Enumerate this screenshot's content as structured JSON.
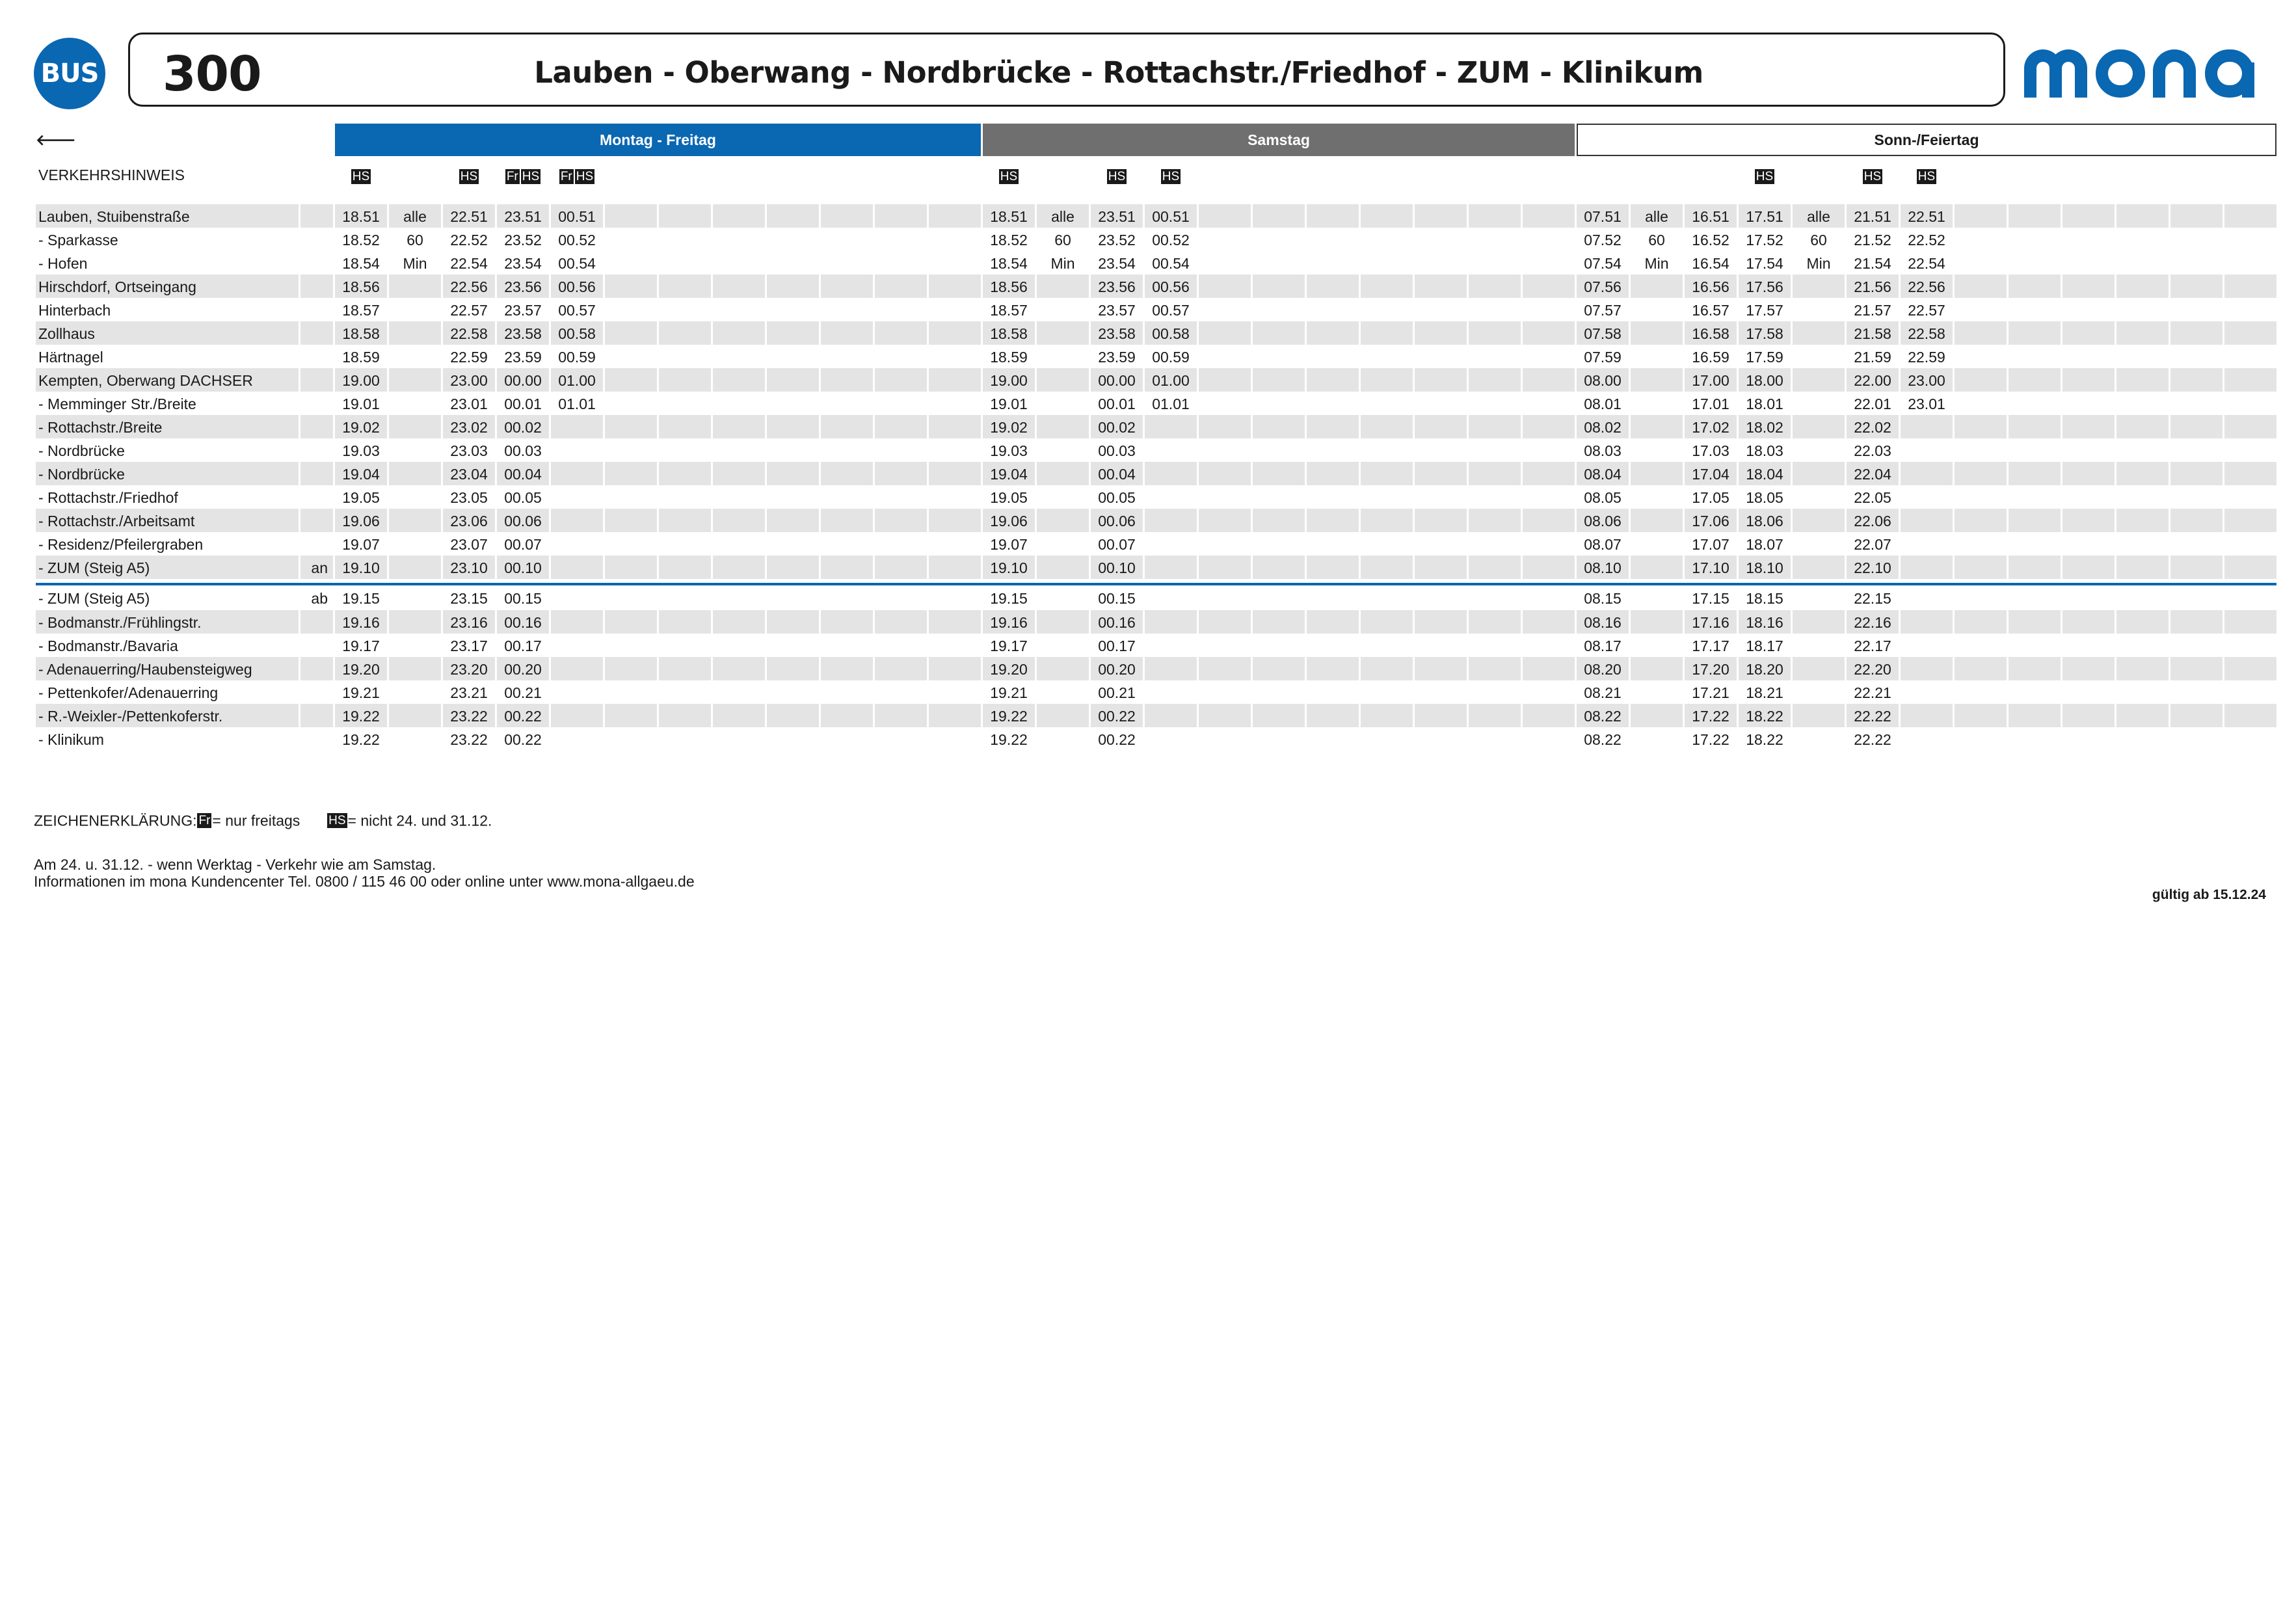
{
  "header": {
    "bus_label": "BUS",
    "line_number": "300",
    "route_title": "Lauben - Oberwang - Nordbrücke - Rottachstr./Friedhof - ZUM - Klinikum",
    "logo_text": "mona",
    "logo_color": "#0a67b2"
  },
  "bands": {
    "back_arrow": "🡐",
    "weekday": "Montag - Freitag",
    "saturday": "Samstag",
    "sunday": "Sonn-/Feiertag",
    "weekday_color": "#0a67b2",
    "saturday_color": "#6f6f6f"
  },
  "notes_label": "VERKEHRSHINWEIS",
  "columns": 36,
  "note_tags": [
    [
      "HS"
    ],
    [],
    [
      "HS"
    ],
    [
      "Fr",
      "HS"
    ],
    [
      "Fr",
      "HS"
    ],
    [],
    [],
    [],
    [],
    [],
    [],
    [],
    [
      "HS"
    ],
    [],
    [
      "HS"
    ],
    [
      "HS"
    ],
    [],
    [],
    [],
    [],
    [],
    [],
    [],
    [],
    [],
    [],
    [
      "HS"
    ],
    [],
    [
      "HS"
    ],
    [
      "HS"
    ],
    [],
    [],
    [],
    [],
    [],
    []
  ],
  "section1": [
    {
      "stop": "Lauben, Stuibenstraße",
      "ank": "",
      "shaded": true,
      "times": [
        "18.51",
        "alle",
        "22.51",
        "23.51",
        "00.51",
        "",
        "",
        "",
        "",
        "",
        "",
        "",
        "18.51",
        "alle",
        "23.51",
        "00.51",
        "",
        "",
        "",
        "",
        "",
        "",
        "",
        "07.51",
        "alle",
        "16.51",
        "17.51",
        "alle",
        "21.51",
        "22.51",
        "",
        "",
        "",
        "",
        "",
        ""
      ]
    },
    {
      "stop": "- Sparkasse",
      "ank": "",
      "shaded": false,
      "times": [
        "18.52",
        "60",
        "22.52",
        "23.52",
        "00.52",
        "",
        "",
        "",
        "",
        "",
        "",
        "",
        "18.52",
        "60",
        "23.52",
        "00.52",
        "",
        "",
        "",
        "",
        "",
        "",
        "",
        "07.52",
        "60",
        "16.52",
        "17.52",
        "60",
        "21.52",
        "22.52",
        "",
        "",
        "",
        "",
        "",
        ""
      ]
    },
    {
      "stop": "- Hofen",
      "ank": "",
      "shaded": false,
      "times": [
        "18.54",
        "Min",
        "22.54",
        "23.54",
        "00.54",
        "",
        "",
        "",
        "",
        "",
        "",
        "",
        "18.54",
        "Min",
        "23.54",
        "00.54",
        "",
        "",
        "",
        "",
        "",
        "",
        "",
        "07.54",
        "Min",
        "16.54",
        "17.54",
        "Min",
        "21.54",
        "22.54",
        "",
        "",
        "",
        "",
        "",
        ""
      ]
    },
    {
      "stop": "Hirschdorf, Ortseingang",
      "ank": "",
      "shaded": true,
      "times": [
        "18.56",
        "",
        "22.56",
        "23.56",
        "00.56",
        "",
        "",
        "",
        "",
        "",
        "",
        "",
        "18.56",
        "",
        "23.56",
        "00.56",
        "",
        "",
        "",
        "",
        "",
        "",
        "",
        "07.56",
        "",
        "16.56",
        "17.56",
        "",
        "21.56",
        "22.56",
        "",
        "",
        "",
        "",
        "",
        ""
      ]
    },
    {
      "stop": "Hinterbach",
      "ank": "",
      "shaded": false,
      "times": [
        "18.57",
        "",
        "22.57",
        "23.57",
        "00.57",
        "",
        "",
        "",
        "",
        "",
        "",
        "",
        "18.57",
        "",
        "23.57",
        "00.57",
        "",
        "",
        "",
        "",
        "",
        "",
        "",
        "07.57",
        "",
        "16.57",
        "17.57",
        "",
        "21.57",
        "22.57",
        "",
        "",
        "",
        "",
        "",
        ""
      ]
    },
    {
      "stop": "Zollhaus",
      "ank": "",
      "shaded": true,
      "times": [
        "18.58",
        "",
        "22.58",
        "23.58",
        "00.58",
        "",
        "",
        "",
        "",
        "",
        "",
        "",
        "18.58",
        "",
        "23.58",
        "00.58",
        "",
        "",
        "",
        "",
        "",
        "",
        "",
        "07.58",
        "",
        "16.58",
        "17.58",
        "",
        "21.58",
        "22.58",
        "",
        "",
        "",
        "",
        "",
        ""
      ]
    },
    {
      "stop": "Härtnagel",
      "ank": "",
      "shaded": false,
      "times": [
        "18.59",
        "",
        "22.59",
        "23.59",
        "00.59",
        "",
        "",
        "",
        "",
        "",
        "",
        "",
        "18.59",
        "",
        "23.59",
        "00.59",
        "",
        "",
        "",
        "",
        "",
        "",
        "",
        "07.59",
        "",
        "16.59",
        "17.59",
        "",
        "21.59",
        "22.59",
        "",
        "",
        "",
        "",
        "",
        ""
      ]
    },
    {
      "stop": "Kempten, Oberwang DACHSER",
      "ank": "",
      "shaded": true,
      "times": [
        "19.00",
        "",
        "23.00",
        "00.00",
        "01.00",
        "",
        "",
        "",
        "",
        "",
        "",
        "",
        "19.00",
        "",
        "00.00",
        "01.00",
        "",
        "",
        "",
        "",
        "",
        "",
        "",
        "08.00",
        "",
        "17.00",
        "18.00",
        "",
        "22.00",
        "23.00",
        "",
        "",
        "",
        "",
        "",
        ""
      ]
    },
    {
      "stop": "- Memminger Str./Breite",
      "ank": "",
      "shaded": false,
      "times": [
        "19.01",
        "",
        "23.01",
        "00.01",
        "01.01",
        "",
        "",
        "",
        "",
        "",
        "",
        "",
        "19.01",
        "",
        "00.01",
        "01.01",
        "",
        "",
        "",
        "",
        "",
        "",
        "",
        "08.01",
        "",
        "17.01",
        "18.01",
        "",
        "22.01",
        "23.01",
        "",
        "",
        "",
        "",
        "",
        ""
      ]
    },
    {
      "stop": "- Rottachstr./Breite",
      "ank": "",
      "shaded": true,
      "times": [
        "19.02",
        "",
        "23.02",
        "00.02",
        "",
        "",
        "",
        "",
        "",
        "",
        "",
        "",
        "19.02",
        "",
        "00.02",
        "",
        "",
        "",
        "",
        "",
        "",
        "",
        "",
        "08.02",
        "",
        "17.02",
        "18.02",
        "",
        "22.02",
        "",
        "",
        "",
        "",
        "",
        "",
        ""
      ]
    },
    {
      "stop": "- Nordbrücke",
      "ank": "",
      "shaded": false,
      "times": [
        "19.03",
        "",
        "23.03",
        "00.03",
        "",
        "",
        "",
        "",
        "",
        "",
        "",
        "",
        "19.03",
        "",
        "00.03",
        "",
        "",
        "",
        "",
        "",
        "",
        "",
        "",
        "08.03",
        "",
        "17.03",
        "18.03",
        "",
        "22.03",
        "",
        "",
        "",
        "",
        "",
        "",
        ""
      ]
    },
    {
      "stop": "- Nordbrücke",
      "ank": "",
      "shaded": true,
      "times": [
        "19.04",
        "",
        "23.04",
        "00.04",
        "",
        "",
        "",
        "",
        "",
        "",
        "",
        "",
        "19.04",
        "",
        "00.04",
        "",
        "",
        "",
        "",
        "",
        "",
        "",
        "",
        "08.04",
        "",
        "17.04",
        "18.04",
        "",
        "22.04",
        "",
        "",
        "",
        "",
        "",
        "",
        ""
      ]
    },
    {
      "stop": "- Rottachstr./Friedhof",
      "ank": "",
      "shaded": false,
      "times": [
        "19.05",
        "",
        "23.05",
        "00.05",
        "",
        "",
        "",
        "",
        "",
        "",
        "",
        "",
        "19.05",
        "",
        "00.05",
        "",
        "",
        "",
        "",
        "",
        "",
        "",
        "",
        "08.05",
        "",
        "17.05",
        "18.05",
        "",
        "22.05",
        "",
        "",
        "",
        "",
        "",
        "",
        ""
      ]
    },
    {
      "stop": "- Rottachstr./Arbeitsamt",
      "ank": "",
      "shaded": true,
      "times": [
        "19.06",
        "",
        "23.06",
        "00.06",
        "",
        "",
        "",
        "",
        "",
        "",
        "",
        "",
        "19.06",
        "",
        "00.06",
        "",
        "",
        "",
        "",
        "",
        "",
        "",
        "",
        "08.06",
        "",
        "17.06",
        "18.06",
        "",
        "22.06",
        "",
        "",
        "",
        "",
        "",
        "",
        ""
      ]
    },
    {
      "stop": "- Residenz/Pfeilergraben",
      "ank": "",
      "shaded": false,
      "times": [
        "19.07",
        "",
        "23.07",
        "00.07",
        "",
        "",
        "",
        "",
        "",
        "",
        "",
        "",
        "19.07",
        "",
        "00.07",
        "",
        "",
        "",
        "",
        "",
        "",
        "",
        "",
        "08.07",
        "",
        "17.07",
        "18.07",
        "",
        "22.07",
        "",
        "",
        "",
        "",
        "",
        "",
        ""
      ]
    },
    {
      "stop": "- ZUM (Steig A5)",
      "ank": "an",
      "shaded": true,
      "times": [
        "19.10",
        "",
        "23.10",
        "00.10",
        "",
        "",
        "",
        "",
        "",
        "",
        "",
        "",
        "19.10",
        "",
        "00.10",
        "",
        "",
        "",
        "",
        "",
        "",
        "",
        "",
        "08.10",
        "",
        "17.10",
        "18.10",
        "",
        "22.10",
        "",
        "",
        "",
        "",
        "",
        "",
        ""
      ]
    }
  ],
  "section2": [
    {
      "stop": "- ZUM (Steig A5)",
      "ank": "ab",
      "shaded": false,
      "times": [
        "19.15",
        "",
        "23.15",
        "00.15",
        "",
        "",
        "",
        "",
        "",
        "",
        "",
        "",
        "19.15",
        "",
        "00.15",
        "",
        "",
        "",
        "",
        "",
        "",
        "",
        "",
        "08.15",
        "",
        "17.15",
        "18.15",
        "",
        "22.15",
        "",
        "",
        "",
        "",
        "",
        "",
        ""
      ]
    },
    {
      "stop": "- Bodmanstr./Frühlingstr.",
      "ank": "",
      "shaded": true,
      "times": [
        "19.16",
        "",
        "23.16",
        "00.16",
        "",
        "",
        "",
        "",
        "",
        "",
        "",
        "",
        "19.16",
        "",
        "00.16",
        "",
        "",
        "",
        "",
        "",
        "",
        "",
        "",
        "08.16",
        "",
        "17.16",
        "18.16",
        "",
        "22.16",
        "",
        "",
        "",
        "",
        "",
        "",
        ""
      ]
    },
    {
      "stop": "- Bodmanstr./Bavaria",
      "ank": "",
      "shaded": false,
      "times": [
        "19.17",
        "",
        "23.17",
        "00.17",
        "",
        "",
        "",
        "",
        "",
        "",
        "",
        "",
        "19.17",
        "",
        "00.17",
        "",
        "",
        "",
        "",
        "",
        "",
        "",
        "",
        "08.17",
        "",
        "17.17",
        "18.17",
        "",
        "22.17",
        "",
        "",
        "",
        "",
        "",
        "",
        ""
      ]
    },
    {
      "stop": "- Adenauerring/Haubensteigweg",
      "ank": "",
      "shaded": true,
      "times": [
        "19.20",
        "",
        "23.20",
        "00.20",
        "",
        "",
        "",
        "",
        "",
        "",
        "",
        "",
        "19.20",
        "",
        "00.20",
        "",
        "",
        "",
        "",
        "",
        "",
        "",
        "",
        "08.20",
        "",
        "17.20",
        "18.20",
        "",
        "22.20",
        "",
        "",
        "",
        "",
        "",
        "",
        ""
      ]
    },
    {
      "stop": "- Pettenkofer/Adenauerring",
      "ank": "",
      "shaded": false,
      "times": [
        "19.21",
        "",
        "23.21",
        "00.21",
        "",
        "",
        "",
        "",
        "",
        "",
        "",
        "",
        "19.21",
        "",
        "00.21",
        "",
        "",
        "",
        "",
        "",
        "",
        "",
        "",
        "08.21",
        "",
        "17.21",
        "18.21",
        "",
        "22.21",
        "",
        "",
        "",
        "",
        "",
        "",
        ""
      ]
    },
    {
      "stop": "- R.-Weixler-/Pettenkoferstr.",
      "ank": "",
      "shaded": true,
      "times": [
        "19.22",
        "",
        "23.22",
        "00.22",
        "",
        "",
        "",
        "",
        "",
        "",
        "",
        "",
        "19.22",
        "",
        "00.22",
        "",
        "",
        "",
        "",
        "",
        "",
        "",
        "",
        "08.22",
        "",
        "17.22",
        "18.22",
        "",
        "22.22",
        "",
        "",
        "",
        "",
        "",
        "",
        ""
      ]
    },
    {
      "stop": "- Klinikum",
      "ank": "",
      "shaded": false,
      "times": [
        "19.22",
        "",
        "23.22",
        "00.22",
        "",
        "",
        "",
        "",
        "",
        "",
        "",
        "",
        "19.22",
        "",
        "00.22",
        "",
        "",
        "",
        "",
        "",
        "",
        "",
        "",
        "08.22",
        "",
        "17.22",
        "18.22",
        "",
        "22.22",
        "",
        "",
        "",
        "",
        "",
        "",
        ""
      ]
    }
  ],
  "legend": {
    "label": "ZEICHENERKLÄRUNG:",
    "fr_tag": "Fr",
    "fr_text": "= nur freitags",
    "hs_tag": "HS",
    "hs_text": "= nicht 24. und 31.12."
  },
  "info": {
    "line1": "Am 24. u. 31.12. - wenn Werktag - Verkehr wie am Samstag.",
    "line2": "Informationen im mona Kundencenter Tel. 0800 / 115 46 00 oder online unter www.mona-allgaeu.de"
  },
  "valid_from": "gültig ab 15.12.24"
}
